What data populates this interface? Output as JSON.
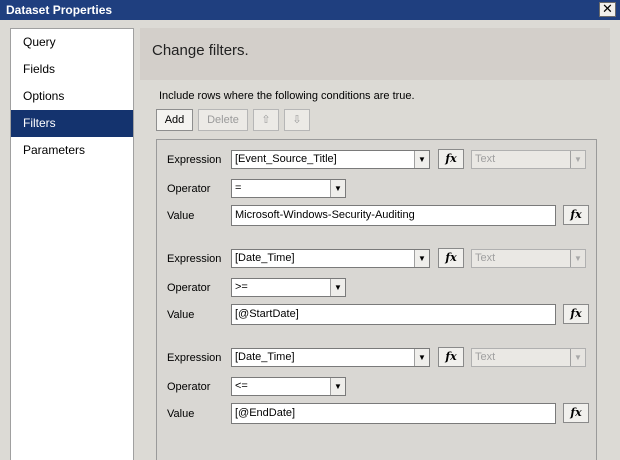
{
  "window": {
    "title": "Dataset Properties",
    "close_glyph": "✕"
  },
  "sidebar": {
    "items": [
      {
        "label": "Query",
        "selected": false
      },
      {
        "label": "Fields",
        "selected": false
      },
      {
        "label": "Options",
        "selected": false
      },
      {
        "label": "Filters",
        "selected": true
      },
      {
        "label": "Parameters",
        "selected": false
      }
    ]
  },
  "header": {
    "title": "Change filters."
  },
  "instruction": "Include rows where the following conditions are true.",
  "toolbar": {
    "add_label": "Add",
    "delete_label": "Delete",
    "move_up_glyph": "⇧",
    "move_down_glyph": "⇩"
  },
  "labels": {
    "expression": "Expression",
    "operator": "Operator",
    "value": "Value",
    "fx": "fx"
  },
  "filters": [
    {
      "expression": "[Event_Source_Title]",
      "type": "Text",
      "operator": "=",
      "value": "Microsoft-Windows-Security-Auditing"
    },
    {
      "expression": "[Date_Time]",
      "type": "Text",
      "operator": ">=",
      "value": "[@StartDate]"
    },
    {
      "expression": "[Date_Time]",
      "type": "Text",
      "operator": "<=",
      "value": "[@EndDate]"
    }
  ],
  "colors": {
    "title_bar": "#1f3f7f",
    "selected_nav": "#14336e",
    "dialog_bg": "#dcdad5"
  }
}
